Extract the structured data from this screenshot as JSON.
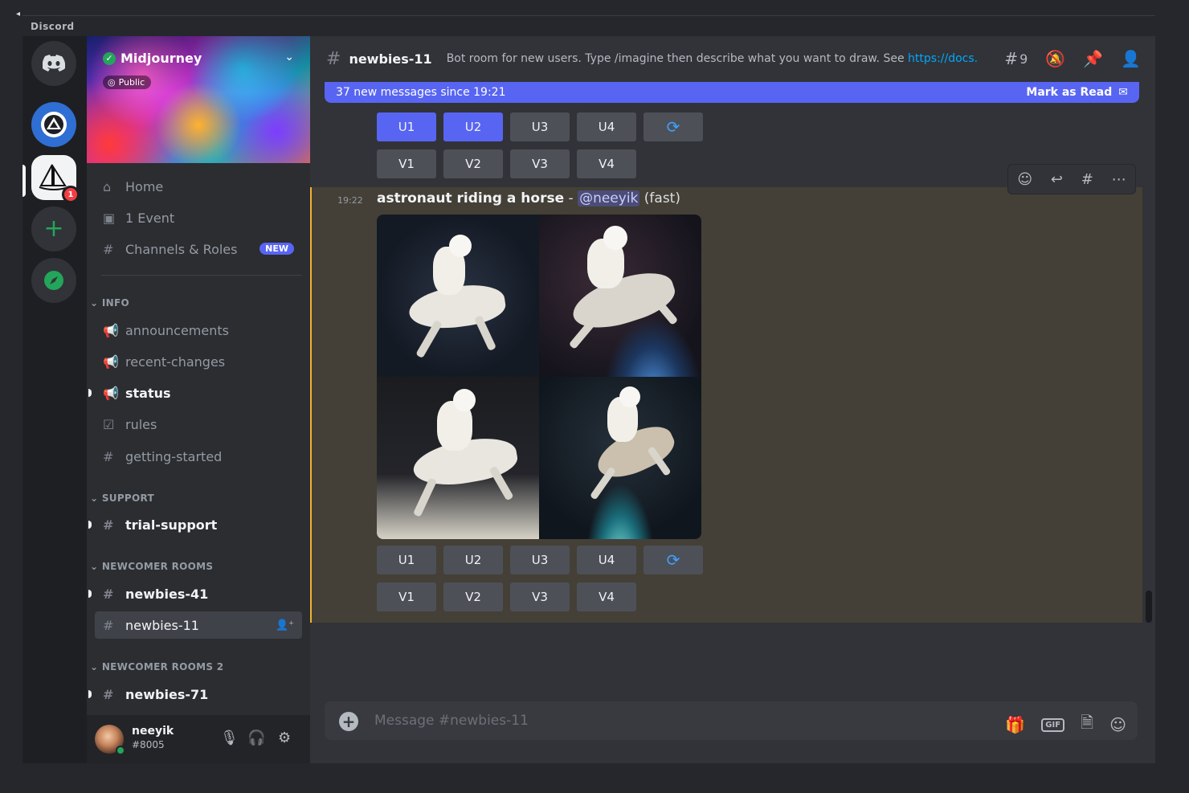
{
  "app": {
    "title": "Discord"
  },
  "server": {
    "name": "Midjourney",
    "visibility": "Public",
    "mention_badge": "1"
  },
  "nav": {
    "home": "Home",
    "events": "1 Event",
    "channels_roles": "Channels & Roles",
    "new_badge": "NEW"
  },
  "categories": {
    "info": "INFO",
    "support": "SUPPORT",
    "newcomer": "NEWCOMER ROOMS",
    "newcomer2": "NEWCOMER ROOMS 2"
  },
  "channels": {
    "announcements": "announcements",
    "recent_changes": "recent-changes",
    "status": "status",
    "rules": "rules",
    "getting_started": "getting-started",
    "trial_support": "trial-support",
    "newbies41": "newbies-41",
    "newbies11": "newbies-11",
    "newbies71": "newbies-71"
  },
  "user": {
    "name": "neeyik",
    "tag": "#8005"
  },
  "header": {
    "channel": "newbies-11",
    "topic": "Bot room for new users. Type /imagine then describe what you want to draw. See ",
    "topic_link": "https://docs...",
    "thread_count": "9"
  },
  "newbar": {
    "text": "37 new messages since 19:21",
    "action": "Mark as Read"
  },
  "buttons": {
    "u1": "U1",
    "u2": "U2",
    "u3": "U3",
    "u4": "U4",
    "v1": "V1",
    "v2": "V2",
    "v3": "V3",
    "v4": "V4",
    "refresh": "⟳"
  },
  "message": {
    "time": "19:22",
    "prompt": "astronaut riding a horse",
    "separator": " - ",
    "mention": "@neeyik",
    "mode": " (fast)"
  },
  "composer": {
    "placeholder": "Message #newbies-11",
    "gif": "GIF"
  },
  "colors": {
    "blurple": "#5865f2",
    "highlight_border": "#f0b232",
    "online": "#23a55a"
  }
}
